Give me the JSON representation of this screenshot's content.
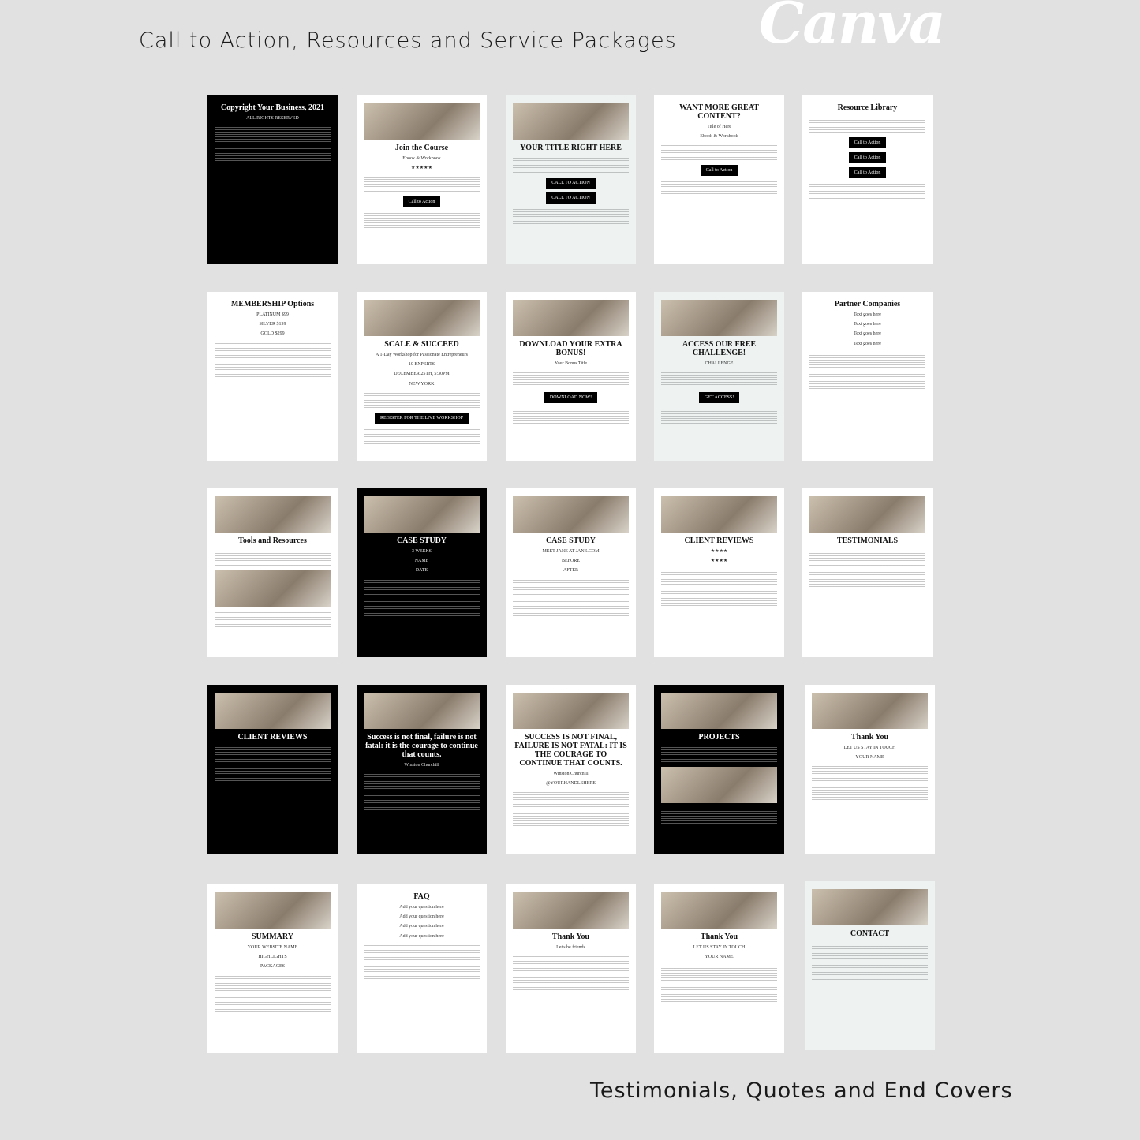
{
  "header": {
    "title": "Call to Action, Resources and Service Packages",
    "logo": "Canva"
  },
  "footer": {
    "title": "Testimonials, Quotes and End Covers"
  },
  "pages": [
    {
      "theme": "dark",
      "heading": "Copyright Your Business, 2021",
      "lines": [
        "ALL RIGHTS RESERVED"
      ],
      "buttons": [],
      "images": 0
    },
    {
      "theme": "light",
      "heading": "Join the Course",
      "lines": [
        "Ebook & Workbook",
        "★★★★★"
      ],
      "buttons": [
        "Call to Action"
      ],
      "images": 1
    },
    {
      "theme": "mint",
      "heading": "YOUR TITLE RIGHT HERE",
      "lines": [],
      "buttons": [
        "CALL TO ACTION",
        "CALL TO ACTION"
      ],
      "images": 1
    },
    {
      "theme": "light",
      "heading": "WANT MORE GREAT CONTENT?",
      "lines": [
        "Title of Here",
        "Ebook & Workbook"
      ],
      "buttons": [
        "Call to Action"
      ],
      "images": 0
    },
    {
      "theme": "light",
      "heading": "Resource Library",
      "lines": [],
      "buttons": [
        "Call to Action",
        "Call to Action",
        "Call to Action"
      ],
      "images": 0
    },
    {
      "theme": "light",
      "heading": "MEMBERSHIP Options",
      "lines": [
        "PLATINUM $99",
        "SILVER $199",
        "GOLD $299"
      ],
      "buttons": [],
      "images": 0
    },
    {
      "theme": "light",
      "heading": "SCALE & SUCCEED",
      "lines": [
        "A 1-Day Workshop for Passionate Entrepreneurs",
        "10 EXPERTS",
        "DECEMBER 25TH, 5:30PM",
        "NEW YORK"
      ],
      "buttons": [
        "REGISTER FOR THE LIVE WORKSHOP"
      ],
      "images": 1
    },
    {
      "theme": "light",
      "heading": "DOWNLOAD YOUR EXTRA BONUS!",
      "lines": [
        "Your Bonus Title"
      ],
      "buttons": [
        "DOWNLOAD NOW!"
      ],
      "images": 1
    },
    {
      "theme": "mint",
      "heading": "ACCESS OUR FREE CHALLENGE!",
      "lines": [
        "CHALLENGE"
      ],
      "buttons": [
        "GET ACCESS!"
      ],
      "images": 1
    },
    {
      "theme": "light",
      "heading": "Partner Companies",
      "lines": [
        "Text goes here",
        "Text goes here",
        "Text goes here",
        "Text goes here"
      ],
      "buttons": [],
      "images": 0
    },
    {
      "theme": "light",
      "heading": "Tools and Resources",
      "lines": [],
      "buttons": [],
      "images": 2
    },
    {
      "theme": "dark",
      "heading": "CASE STUDY",
      "lines": [
        "3 WEEKS",
        "NAME",
        "DATE"
      ],
      "buttons": [],
      "images": 1
    },
    {
      "theme": "light",
      "heading": "CASE STUDY",
      "lines": [
        "MEET JANE AT JANE.COM",
        "BEFORE",
        "AFTER"
      ],
      "buttons": [],
      "images": 1
    },
    {
      "theme": "light",
      "heading": "CLIENT REVIEWS",
      "lines": [
        "★★★★",
        "★★★★"
      ],
      "buttons": [],
      "images": 1
    },
    {
      "theme": "light",
      "heading": "TESTIMONIALS",
      "lines": [],
      "buttons": [],
      "images": 1
    },
    {
      "theme": "dark",
      "heading": "CLIENT REVIEWS",
      "lines": [],
      "buttons": [],
      "images": 1
    },
    {
      "theme": "dark",
      "heading": "Success is not final, failure is not fatal: it is the courage to continue that counts.",
      "lines": [
        "Winston Churchill"
      ],
      "buttons": [],
      "images": 1
    },
    {
      "theme": "light",
      "heading": "SUCCESS IS NOT FINAL, FAILURE IS NOT FATAL: IT IS THE COURAGE TO CONTINUE THAT COUNTS.",
      "lines": [
        "Winston Churchill",
        "@YOURHANDLEHERE"
      ],
      "buttons": [],
      "images": 1
    },
    {
      "theme": "dark",
      "heading": "PROJECTS",
      "lines": [],
      "buttons": [],
      "images": 2
    },
    {
      "theme": "light",
      "heading": "Thank You",
      "lines": [
        "LET US STAY IN TOUCH",
        "YOUR NAME"
      ],
      "buttons": [],
      "images": 1
    },
    {
      "theme": "light",
      "heading": "SUMMARY",
      "lines": [
        "YOUR WEBSITE NAME",
        "HIGHLIGHTS",
        "PACKAGES"
      ],
      "buttons": [],
      "images": 1
    },
    {
      "theme": "light",
      "heading": "FAQ",
      "lines": [
        "Add your question here",
        "Add your question here",
        "Add your question here",
        "Add your question here"
      ],
      "buttons": [],
      "images": 0
    },
    {
      "theme": "light",
      "heading": "Thank You",
      "lines": [
        "Let's be friends"
      ],
      "buttons": [],
      "images": 1
    },
    {
      "theme": "light",
      "heading": "Thank You",
      "lines": [
        "LET US STAY IN TOUCH",
        "YOUR NAME"
      ],
      "buttons": [],
      "images": 1
    },
    {
      "theme": "mint",
      "heading": "CONTACT",
      "lines": [],
      "buttons": [],
      "images": 1
    }
  ]
}
